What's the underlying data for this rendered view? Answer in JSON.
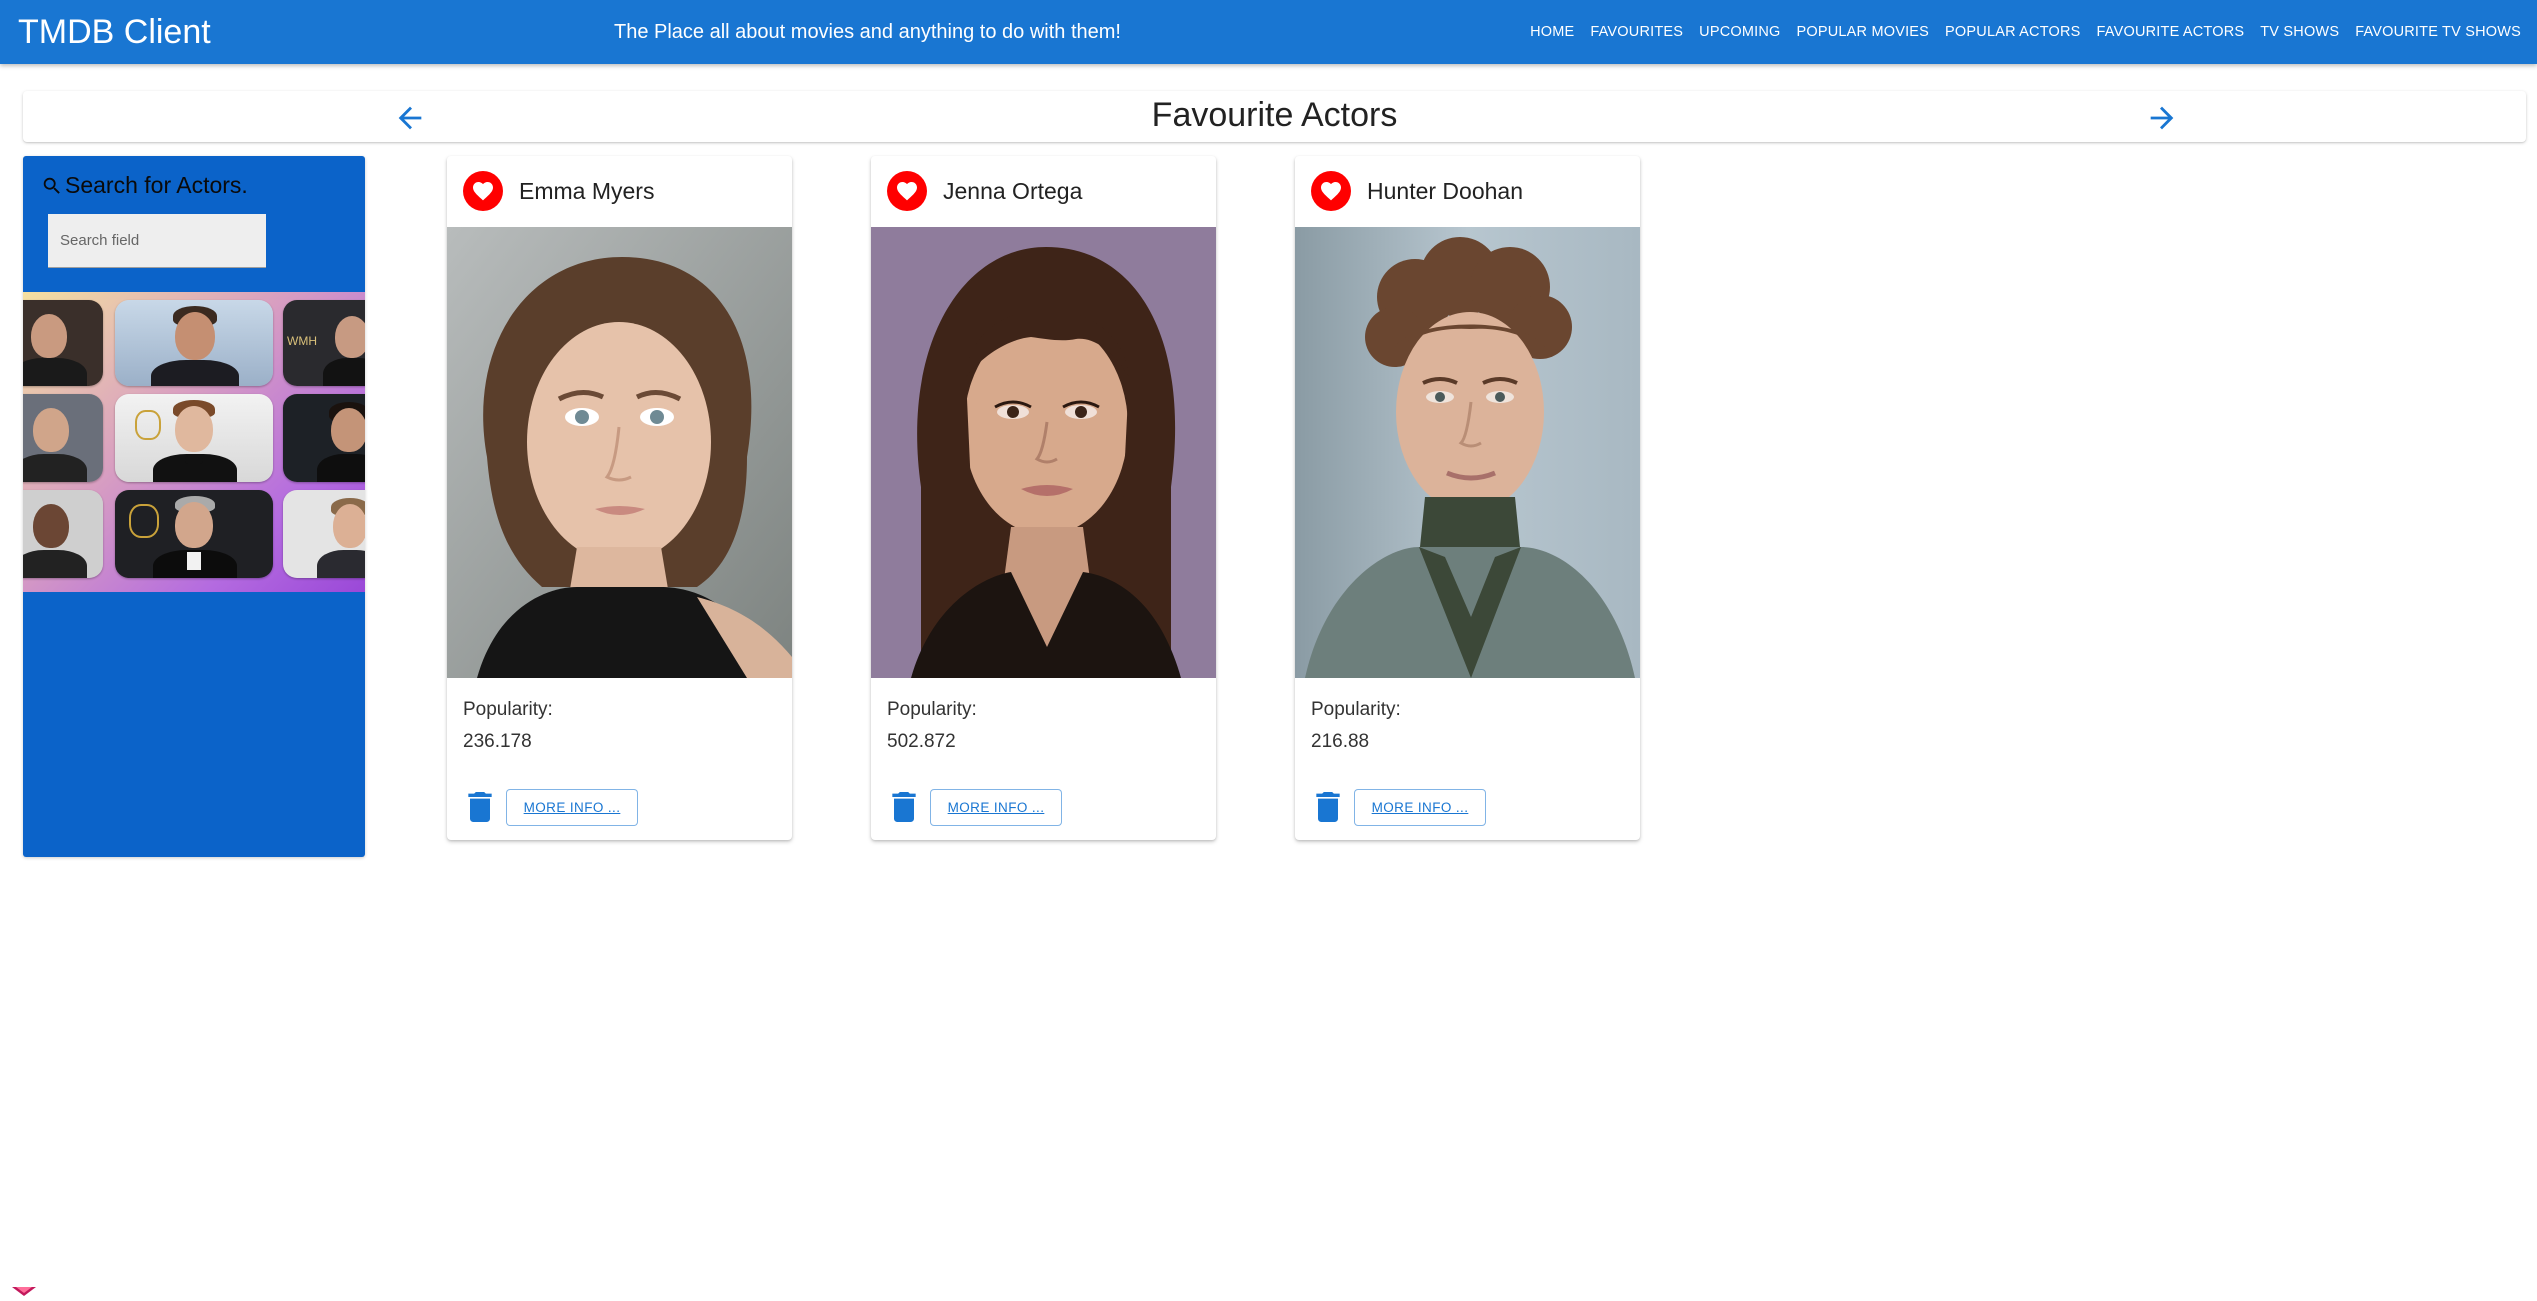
{
  "app": {
    "brand": "TMDB Client",
    "tagline": "The Place all about movies and anything to do with them!"
  },
  "nav": {
    "items": [
      {
        "label": "Home"
      },
      {
        "label": "Favourites"
      },
      {
        "label": "Upcoming"
      },
      {
        "label": "Popular Movies"
      },
      {
        "label": "Popular Actors"
      },
      {
        "label": "Favourite Actors"
      },
      {
        "label": "TV Shows"
      },
      {
        "label": "Favourite TV Shows"
      }
    ]
  },
  "page": {
    "title": "Favourite Actors",
    "back_icon": "arrow-back-icon",
    "forward_icon": "arrow-forward-icon"
  },
  "filter": {
    "title": "Search for Actors.",
    "icon": "search-icon",
    "search_placeholder": "Search field",
    "search_value": ""
  },
  "cards": [
    {
      "name": "Emma Myers",
      "popularity_label": "Popularity:",
      "popularity_value": "236.178",
      "more_label": "More Info ..."
    },
    {
      "name": "Jenna Ortega",
      "popularity_label": "Popularity:",
      "popularity_value": "502.872",
      "more_label": "More Info ..."
    },
    {
      "name": "Hunter Doohan",
      "popularity_label": "Popularity:",
      "popularity_value": "216.88",
      "more_label": "More Info ..."
    }
  ],
  "colors": {
    "appbar": "#1976d2",
    "filter_panel": "#0b63c9",
    "favourite": "#ff0000",
    "accent": "#1976d2"
  }
}
